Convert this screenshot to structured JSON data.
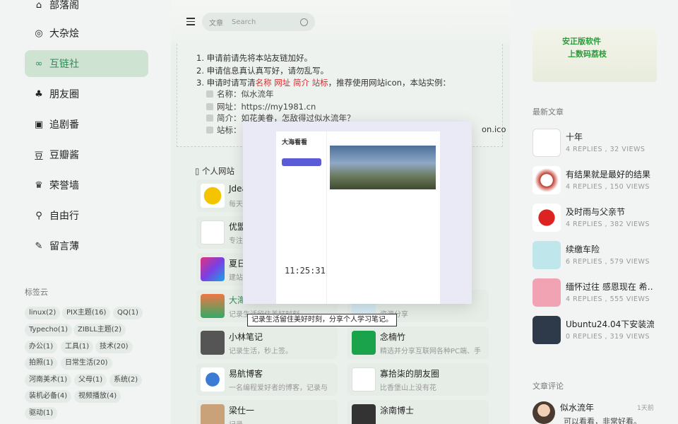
{
  "sidebar": {
    "items": [
      {
        "label": "部落阁",
        "icon": "home-icon"
      },
      {
        "label": "大杂烩",
        "icon": "target-icon"
      },
      {
        "label": "互链社",
        "icon": "link-icon",
        "active": true
      },
      {
        "label": "朋友圈",
        "icon": "tree-icon"
      },
      {
        "label": "追剧番",
        "icon": "tv-icon"
      },
      {
        "label": "豆瓣酱",
        "icon": "bean-icon"
      },
      {
        "label": "荣誉墙",
        "icon": "award-icon"
      },
      {
        "label": "自由行",
        "icon": "map-icon"
      },
      {
        "label": "留言薄",
        "icon": "edit-icon"
      }
    ],
    "tag_title": "标签云",
    "tags": [
      "linux(2)",
      "PIX主题(16)",
      "QQ(1)",
      "Typecho(1)",
      "ZIBLL主题(2)",
      "办公(1)",
      "工具(1)",
      "技术(20)",
      "拍照(1)",
      "日常生活(20)",
      "河南美术(1)",
      "父母(1)",
      "系统(2)",
      "装机必备(4)",
      "视频播放(4)",
      "驱动(1)"
    ]
  },
  "header": {
    "search_category": "文章",
    "search_placeholder": "Search"
  },
  "apply": {
    "lines": [
      "1. 申请前请先将本站友链加好。",
      "2. 申请信息真认真写好，请勿乱写。"
    ],
    "line3_pre": "3. 申请时请写清",
    "line3_red": "名称 网址 简介 站标",
    "line3_post": "，推荐使用网站icon，本站实例：",
    "items": [
      "名称：似水流年",
      "网址：https://my1981.cn",
      "简介：如花美眷，怎敌得过似水流年？",
      "站标："
    ],
    "icon_suffix": "on.ico"
  },
  "links": {
    "title": "个人网站",
    "cards": [
      {
        "name": "Jdea",
        "desc": "每天"
      },
      {
        "name": "优盟",
        "desc": "专注"
      },
      {
        "name": "夏日",
        "desc": "建站"
      },
      {
        "name": "大海",
        "desc": "记录生活留住美好时刻"
      },
      {
        "name": "",
        "desc": "资源分享"
      },
      {
        "name": "小林笔记",
        "desc": "记录生活，秒上签。"
      },
      {
        "name": "念楠竹",
        "desc": "精选并分享互联网各种PC端、手"
      },
      {
        "name": "易航博客",
        "desc": "一名编程爱好者的博客，记录与"
      },
      {
        "name": "寡拾柒的朋友圈",
        "desc": "比香堡山上没有花"
      },
      {
        "name": "梁仕一",
        "desc": "记录"
      },
      {
        "name": "涂南博士",
        "desc": ""
      }
    ]
  },
  "preview": {
    "site_name": "大海看看",
    "clock": "11:25:31",
    "tooltip": "记录生活留住美好时刻，分享个人学习笔记。"
  },
  "right": {
    "ad_line1": "安正版软件",
    "ad_line2": "上数码荔枝",
    "recent_title": "最新文章",
    "posts": [
      {
        "title": "十年",
        "meta": "4 REPLIES ,  32 VIEWS"
      },
      {
        "title": "有结果就是最好的结果",
        "meta": "4 REPLIES ,  150 VIEWS"
      },
      {
        "title": "及时雨与父亲节",
        "meta": "4 REPLIES ,  382 VIEWS"
      },
      {
        "title": "续缴车险",
        "meta": "6 REPLIES ,  579 VIEWS"
      },
      {
        "title": "缅怀过往 感恩现在 希…",
        "meta": "4 REPLIES ,  555 VIEWS"
      },
      {
        "title": "Ubuntu24.04下安装流…",
        "meta": "0 REPLIES ,  319 VIEWS"
      }
    ],
    "comment_title": "文章评论",
    "comment_name": "似水流年",
    "comment_time": "1天前",
    "comment_text": "可以看看，非常好看。"
  }
}
